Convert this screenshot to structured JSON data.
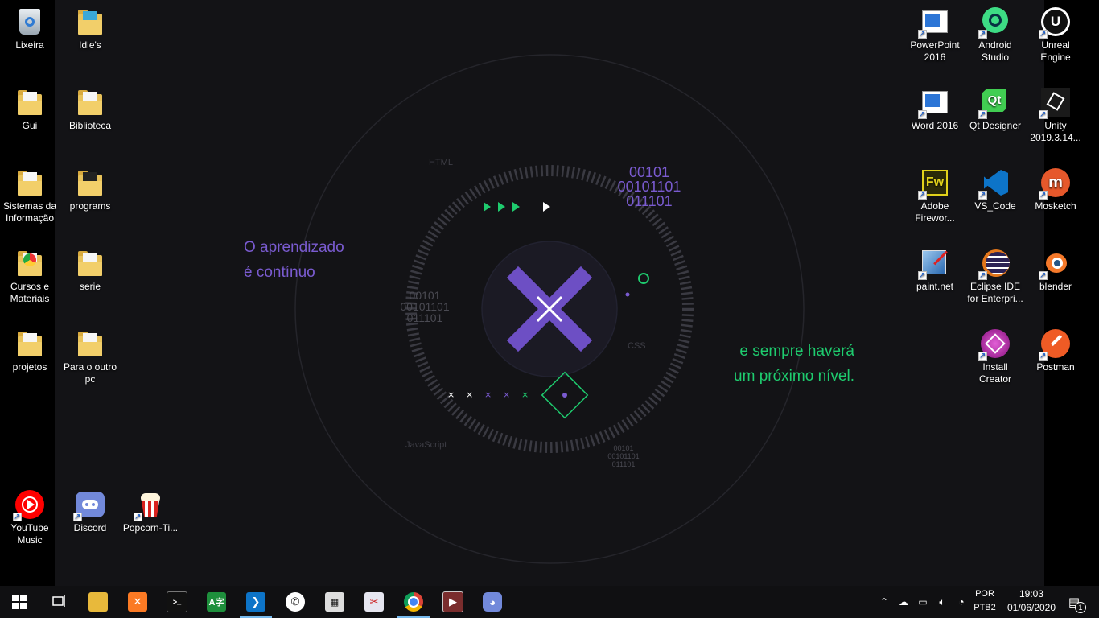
{
  "wallpaper": {
    "text_left_1": "O aprendizado",
    "text_left_2": "é contínuo",
    "text_right_1": "e sempre haverá",
    "text_right_2": "um próximo nível.",
    "bin_top_1": "00101",
    "bin_top_2": "00101101",
    "bin_top_3": "011101",
    "bin_left_1": "00101",
    "bin_left_2": "00101101",
    "bin_left_3": "011101",
    "bin_bottom_1": "00101",
    "bin_bottom_2": "00101101",
    "bin_bottom_3": "011101",
    "label_html": "HTML",
    "label_css": "CSS",
    "label_js": "JavaScript",
    "colors": {
      "purple": "#7a5bd0",
      "green": "#1ecb6e",
      "bg": "#131316"
    }
  },
  "desktop_icons": {
    "lixeira": "Lixeira",
    "idles": "Idle's",
    "gui": "Gui",
    "biblioteca": "Biblioteca",
    "sistemas": "Sistemas da Informação",
    "programs": "programs",
    "cursos": "Cursos e Materiais",
    "serie": "serie",
    "projetos": "projetos",
    "para_outro_pc": "Para o outro pc",
    "youtube_music": "YouTube Music",
    "discord": "Discord",
    "popcorn": "Popcorn-Ti...",
    "powerpoint": "PowerPoint 2016",
    "android_studio": "Android Studio",
    "unreal": "Unreal Engine",
    "word": "Word 2016",
    "qt_designer": "Qt Designer",
    "unity": "Unity 2019.3.14...",
    "fireworks": "Adobe Firewor...",
    "vscode": "VS_Code",
    "mosketch": "Mosketch",
    "paintnet": "paint.net",
    "eclipse": "Eclipse IDE for Enterpri...",
    "blender": "blender",
    "install_creator": "Install Creator",
    "postman": "Postman"
  },
  "taskbar": {
    "lang_1": "POR",
    "lang_2": "PTB2",
    "time": "19:03",
    "date": "01/06/2020",
    "notification_count": "1",
    "start_icon": "windows-logo-icon",
    "task_view_icon": "task-view-icon"
  }
}
